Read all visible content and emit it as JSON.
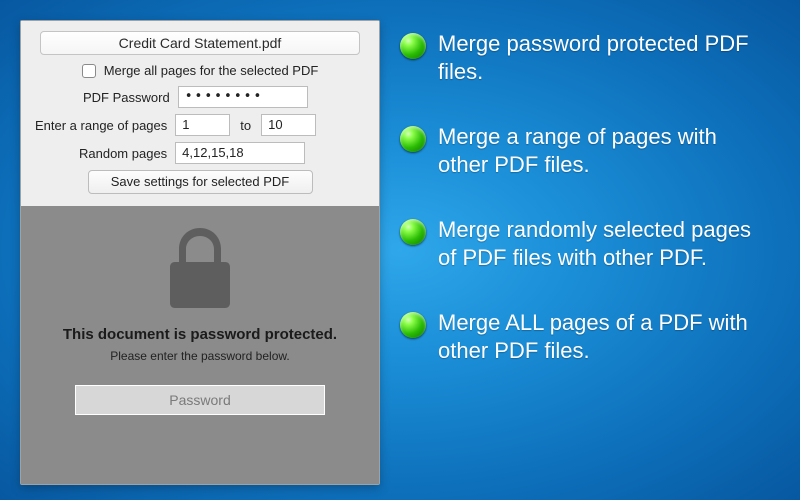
{
  "panel": {
    "filename": "Credit Card Statement.pdf",
    "merge_all_label": "Merge all pages for the selected PDF",
    "pdf_password_label": "PDF Password",
    "pdf_password_value": "••••••••",
    "range_label": "Enter a range of pages",
    "range_from": "1",
    "range_to_label": "to",
    "range_to": "10",
    "random_label": "Random pages",
    "random_value": "4,12,15,18",
    "save_settings_label": "Save settings for selected PDF",
    "protected_title": "This document is password protected.",
    "protected_sub": "Please enter the password below.",
    "password_placeholder": "Password"
  },
  "features": [
    "Merge password protected PDF files.",
    "Merge a range of pages with other PDF files.",
    "Merge randomly selected pages of PDF files with other PDF.",
    "Merge ALL pages of a PDF with other PDF files."
  ],
  "colors": {
    "bullet_green": "#2bbd05",
    "bg_blue": "#147bc7",
    "panel_gray": "#eeeeee",
    "locked_gray": "#8b8b8b"
  }
}
